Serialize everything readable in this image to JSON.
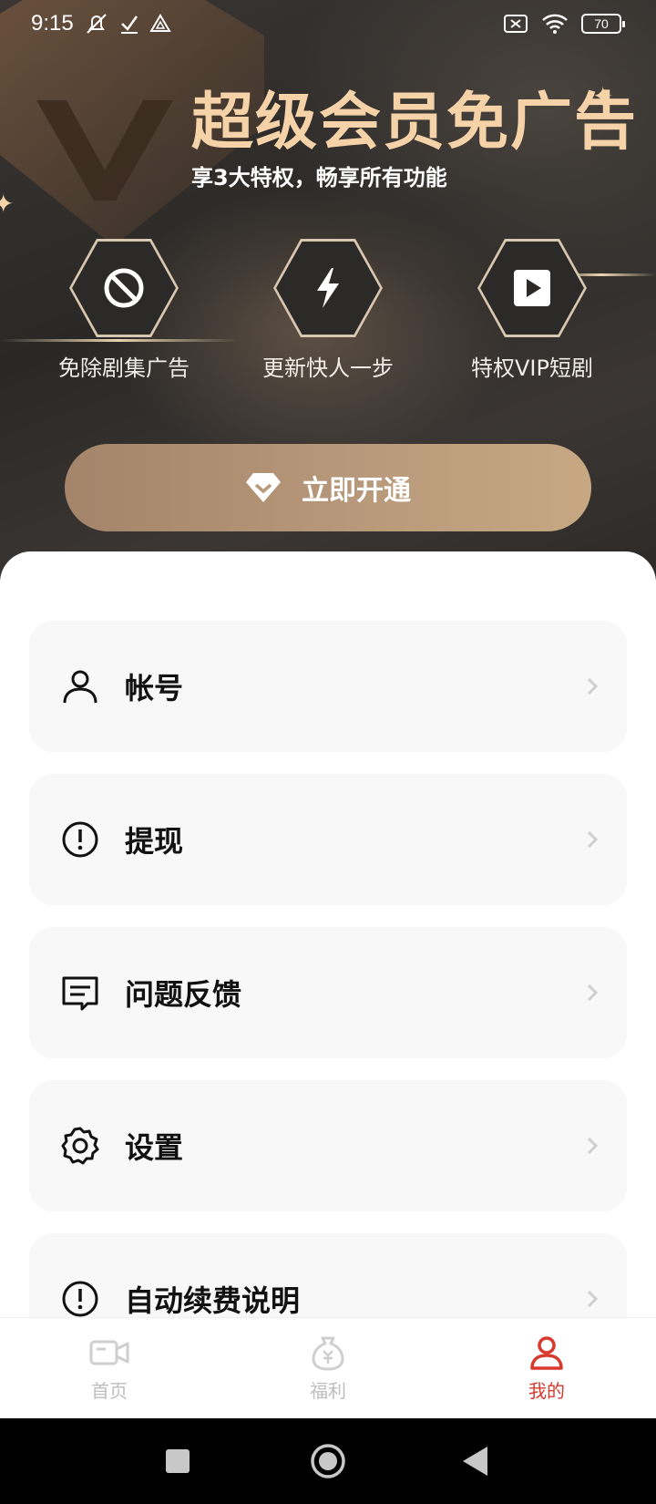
{
  "status_bar": {
    "time": "9:15",
    "battery": "70",
    "left_icons": [
      "muted-icon",
      "check-icon",
      "drive-icon"
    ],
    "right_icons": [
      "sim-off-icon",
      "wifi-icon",
      "battery-icon"
    ]
  },
  "hero": {
    "title": "超级会员免广告",
    "subtitle": "享3大特权，畅享所有功能",
    "features": [
      {
        "label": "免除剧集广告",
        "icon": "no-ads-icon"
      },
      {
        "label": "更新快人一步",
        "icon": "lightning-icon"
      },
      {
        "label": "特权VIP短剧",
        "icon": "play-icon"
      }
    ],
    "cta_label": "立即开通",
    "cta_icon": "diamond-icon",
    "accent_color": "#f6d2a8"
  },
  "menu": {
    "items": [
      {
        "label": "帐号",
        "icon": "user-icon"
      },
      {
        "label": "提现",
        "icon": "alert-circle-icon"
      },
      {
        "label": "问题反馈",
        "icon": "message-icon"
      },
      {
        "label": "设置",
        "icon": "gear-icon"
      },
      {
        "label": "自动续费说明",
        "icon": "alert-circle-icon"
      }
    ]
  },
  "bottom_nav": {
    "items": [
      {
        "label": "首页",
        "icon": "video-camera-icon",
        "active": false
      },
      {
        "label": "福利",
        "icon": "money-bag-icon",
        "active": false
      },
      {
        "label": "我的",
        "icon": "user-icon",
        "active": true
      }
    ],
    "active_color": "#d9392c"
  }
}
